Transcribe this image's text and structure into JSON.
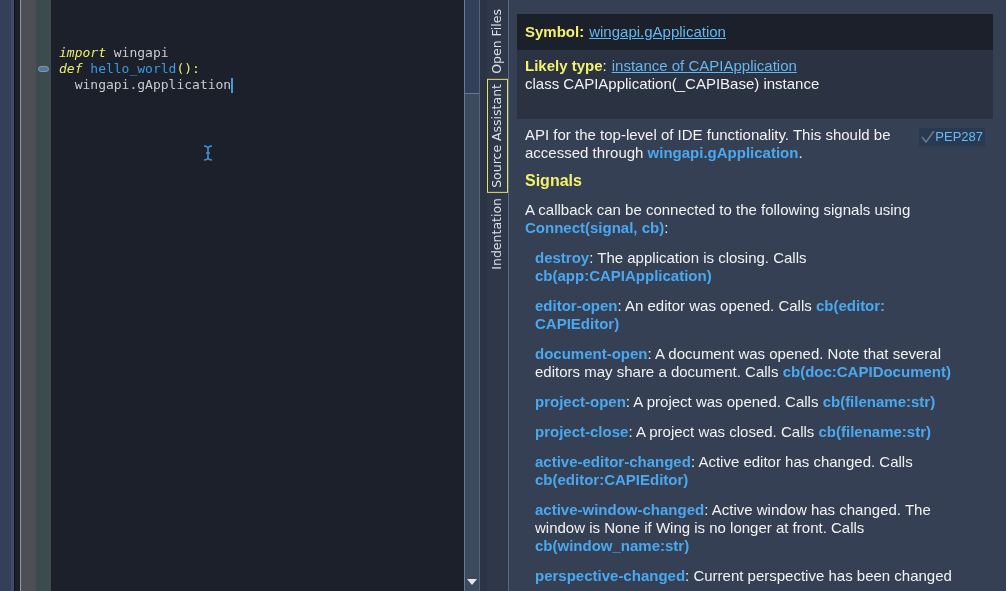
{
  "editor": {
    "lines": [
      {
        "marker": false,
        "cursor": false,
        "tokens": [
          {
            "kind": "keyword",
            "text": "import"
          },
          {
            "kind": "plain",
            "text": " wingapi"
          }
        ]
      },
      {
        "marker": true,
        "cursor": false,
        "tokens": [
          {
            "kind": "keyword",
            "text": "def"
          },
          {
            "kind": "name",
            "text": " hello_world"
          },
          {
            "kind": "punct",
            "text": "():"
          }
        ]
      },
      {
        "marker": false,
        "cursor": true,
        "tokens": [
          {
            "kind": "plain",
            "text": "  wingapi.gApplication"
          }
        ]
      }
    ]
  },
  "side_tabs": [
    {
      "label": "Open Files",
      "selected": false
    },
    {
      "label": "Source Assistant",
      "selected": true
    },
    {
      "label": "Indentation",
      "selected": false
    }
  ],
  "assistant": {
    "symbol": {
      "label": "Symbol:",
      "value": "wingapi.gApplication"
    },
    "likely_type": {
      "label": "Likely type",
      "separator": ":",
      "value": "instance of CAPIApplication",
      "description": "class CAPIApplication(_CAPIBase) instance"
    },
    "description": "API for the top-level of IDE functionality. This should be accessed through **wingapi.gApplication**.",
    "badge": "PEP287",
    "signals_heading": "Signals",
    "signals_intro": "A callback can be connected to the following signals using **Connect(signal, cb)**:",
    "signals": [
      "**destroy**: The application is closing. Calls **cb(app:CAPIApplication)**",
      "**editor-open**: An editor was opened. Calls **cb(editor: CAPIEditor)**",
      "**document-open**: A document was opened. Note that several editors may share a document. Calls **cb(doc:CAPIDocument)**",
      "**project-open**: A project was opened. Calls **cb(filename:str)**",
      "**project-close**: A project was closed. Calls **cb(filename:str)**",
      "**active-editor-changed**: Active editor has changed. Calls **cb(editor:CAPIEditor)**",
      "**active-window-changed**: Active window has changed. The window is None if Wing is no longer at front. Calls **cb(window_name:str)**",
      "**perspective-changed**: Current perspective has been changed"
    ]
  }
}
